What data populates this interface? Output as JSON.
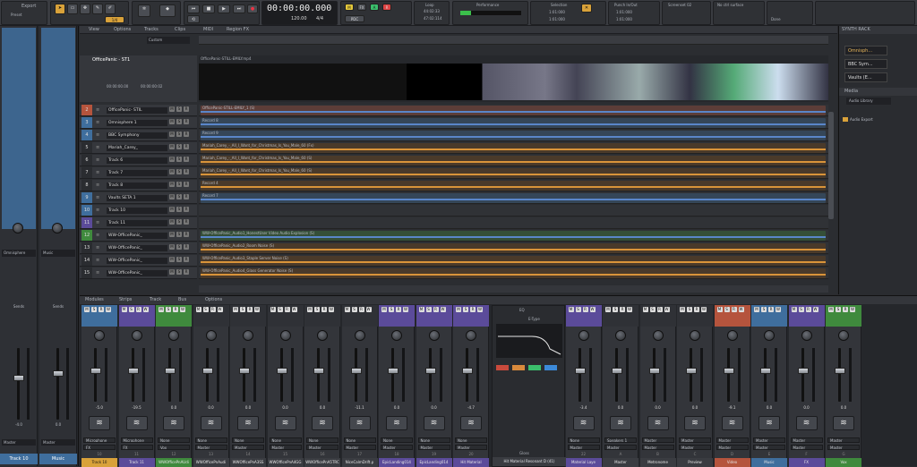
{
  "transport": {
    "export_label": "Export",
    "preset_label": "Preset",
    "selection_label": "Selection",
    "time_main": "00:00:00.000",
    "tempo": "120.00",
    "meter": "4/4",
    "sync_status": "Loop",
    "time_left": "44:02:33",
    "time_right": "47:02:114",
    "performance_label": "Performance",
    "selection_start": "1:01:000",
    "selection_end": "1:01:000",
    "punch_label": "Punch In/Out",
    "punch_start": "1:01:000",
    "punch_end": "1:01:000",
    "screenset_label": "Screenset 02",
    "control_surface": "No ctrl surface",
    "done_label": "Done"
  },
  "menu": [
    "View",
    "Options",
    "Tracks",
    "Clips",
    "MIDI",
    "Region FX"
  ],
  "custom_label": "Custom",
  "video_track": {
    "name": "OfficePanic - ST1",
    "clip": "OfficePanic-STILL-EMILY.mp4",
    "time1": "00:00:00.00",
    "time2": "00:00:00:02"
  },
  "tracks": [
    {
      "num": "2",
      "name": "OfficePanic- STIL",
      "color": "#b5543d",
      "clip": "OfficePanic-STILL-EMILY_1 (S)"
    },
    {
      "num": "3",
      "name": "Omnisphere 1",
      "color": "#3f6e9d",
      "clip": "Record 8"
    },
    {
      "num": "4",
      "name": "BBC Symphony",
      "color": "#3f6e9d",
      "clip": "Record 9"
    },
    {
      "num": "5",
      "name": "Mariah_Carey_",
      "color": "#2a2c30",
      "clip": "Mariah_Carey_-_All_I_Want_for_Christmas_Is_You_Male_60 (Fx)"
    },
    {
      "num": "6",
      "name": "Track 6",
      "color": "#2a2c30",
      "clip": "Mariah_Carey_-_All_I_Want_for_Christmas_Is_You_Male_60 (S)"
    },
    {
      "num": "7",
      "name": "Track 7",
      "color": "#2a2c30",
      "clip": "Mariah_Carey_-_All_I_Want_for_Christmas_Is_You_Male_60 (S)"
    },
    {
      "num": "8",
      "name": "Track 8",
      "color": "#2a2c30",
      "clip": "Record 4"
    },
    {
      "num": "9",
      "name": "Vaults SETA 1",
      "color": "#3f6e9d",
      "clip": "Record 7"
    },
    {
      "num": "10",
      "name": "Track 10",
      "color": "#3f6e9d",
      "clip": ""
    },
    {
      "num": "11",
      "name": "Track 11",
      "color": "#5b4b9a",
      "clip": ""
    },
    {
      "num": "12",
      "name": "WW-OfficePanic_",
      "color": "#3f8a3d",
      "clip": "WW-OfficePanic_Audio1_HonestUser Video Audio Explosion (S)"
    },
    {
      "num": "13",
      "name": "WW-OfficePanic_",
      "color": "#2a2c30",
      "clip": "WW-OfficePanic_Audio2_Room Noise (S)"
    },
    {
      "num": "14",
      "name": "WW-OfficePanic_",
      "color": "#2a2c30",
      "clip": "WW-OfficePanic_Audio3_Staple Server Noise (S)"
    },
    {
      "num": "15",
      "name": "WW-OfficePanic_",
      "color": "#2a2c30",
      "clip": "WW-OfficePanic_Audio4_Glass Generator Noise (S)"
    }
  ],
  "rack": {
    "title": "SYNTH RACK",
    "instruments": [
      "Omnisph...",
      "BBC Sym...",
      "Vaults (E..."
    ],
    "media": "Media",
    "library": "Audio Library",
    "folder": "Audio Export"
  },
  "left_strips": [
    {
      "name": "Track 10",
      "vol": "-4.0",
      "input": "Omnisphere",
      "output": "Master",
      "send": "Sends"
    },
    {
      "name": "Music",
      "vol": "0.0",
      "input": "Music",
      "output": "Master",
      "send": "Sends"
    }
  ],
  "mixer_tabs": [
    "Modules",
    "Strips",
    "Track",
    "Bus",
    "Options"
  ],
  "mixer_channels": [
    {
      "name": "Track 10",
      "color": "#3f6e9d",
      "vol": "-5.0",
      "io_in": "Microphone",
      "io_out": "FX",
      "num": "10",
      "hl": true
    },
    {
      "name": "Track 11",
      "color": "#5b4b9a",
      "vol": "-19.5",
      "io_in": "Microphone",
      "io_out": "FX",
      "num": "11",
      "hl": false
    },
    {
      "name": "WWOfficePnAUdi",
      "color": "#3f8a3d",
      "vol": "0.0",
      "io_in": "None",
      "io_out": "Vox",
      "num": "12",
      "hl": false
    },
    {
      "name": "WWOfficePnAudi",
      "color": "#2f3136",
      "vol": "0.0",
      "io_in": "None",
      "io_out": "Master",
      "num": "13",
      "hl": false
    },
    {
      "name": "WWOfficePnA3SS",
      "color": "#2f3136",
      "vol": "0.0",
      "io_in": "None",
      "io_out": "Master",
      "num": "14",
      "hl": false
    },
    {
      "name": "WWOfficePnA4GG",
      "color": "#2f3136",
      "vol": "0.0",
      "io_in": "None",
      "io_out": "Master",
      "num": "15",
      "hl": false
    },
    {
      "name": "WWOfficePnA5TRC",
      "color": "#2f3136",
      "vol": "0.0",
      "io_in": "None",
      "io_out": "Master",
      "num": "16",
      "hl": false
    },
    {
      "name": "NiceCalmDrift.p",
      "color": "#2f3136",
      "vol": "-11.1",
      "io_in": "None",
      "io_out": "Master",
      "num": "17",
      "hl": false
    },
    {
      "name": "EpicLanding014",
      "color": "#5b4b9a",
      "vol": "0.0",
      "io_in": "None",
      "io_out": "Master",
      "num": "18",
      "hl": false
    },
    {
      "name": "EpicLanding014",
      "color": "#5b4b9a",
      "vol": "0.0",
      "io_in": "None",
      "io_out": "Master",
      "num": "19",
      "hl": false
    },
    {
      "name": "Hit Material",
      "color": "#5b4b9a",
      "vol": "-4.7",
      "io_in": "None",
      "io_out": "Master",
      "num": "20",
      "hl": false
    },
    {
      "name": "Material Laye",
      "color": "#5b4b9a",
      "vol": "-3.4",
      "io_in": "None",
      "io_out": "Master",
      "num": "22",
      "hl": false
    },
    {
      "name": "Master",
      "color": "#2f3136",
      "vol": "0.0",
      "io_in": "Speakers 1",
      "io_out": "Master",
      "num": "A",
      "hl": false
    },
    {
      "name": "Metronome",
      "color": "#2f3136",
      "vol": "0.0",
      "io_in": "Master",
      "io_out": "Master",
      "num": "B",
      "hl": false
    },
    {
      "name": "Preview",
      "color": "#2f3136",
      "vol": "0.0",
      "io_in": "Master",
      "io_out": "Master",
      "num": "C",
      "hl": false
    },
    {
      "name": "Video",
      "color": "#b5543d",
      "vol": "-9.1",
      "io_in": "Master",
      "io_out": "Master",
      "num": "D",
      "hl": false
    },
    {
      "name": "Music",
      "color": "#3f6e9d",
      "vol": "0.0",
      "io_in": "Master",
      "io_out": "Master",
      "num": "E",
      "hl": false
    },
    {
      "name": "FX",
      "color": "#5b4b9a",
      "vol": "0.0",
      "io_in": "Master",
      "io_out": "Master",
      "num": "F",
      "hl": false
    },
    {
      "name": "Vox",
      "color": "#3f8a3d",
      "vol": "0.0",
      "io_in": "Master",
      "io_out": "Master",
      "num": "G",
      "hl": false
    }
  ],
  "eq_panel": {
    "title": "EQ",
    "name": "Hit Material Resonant D (41)",
    "type": "E-Type",
    "footer": "Gloss"
  }
}
